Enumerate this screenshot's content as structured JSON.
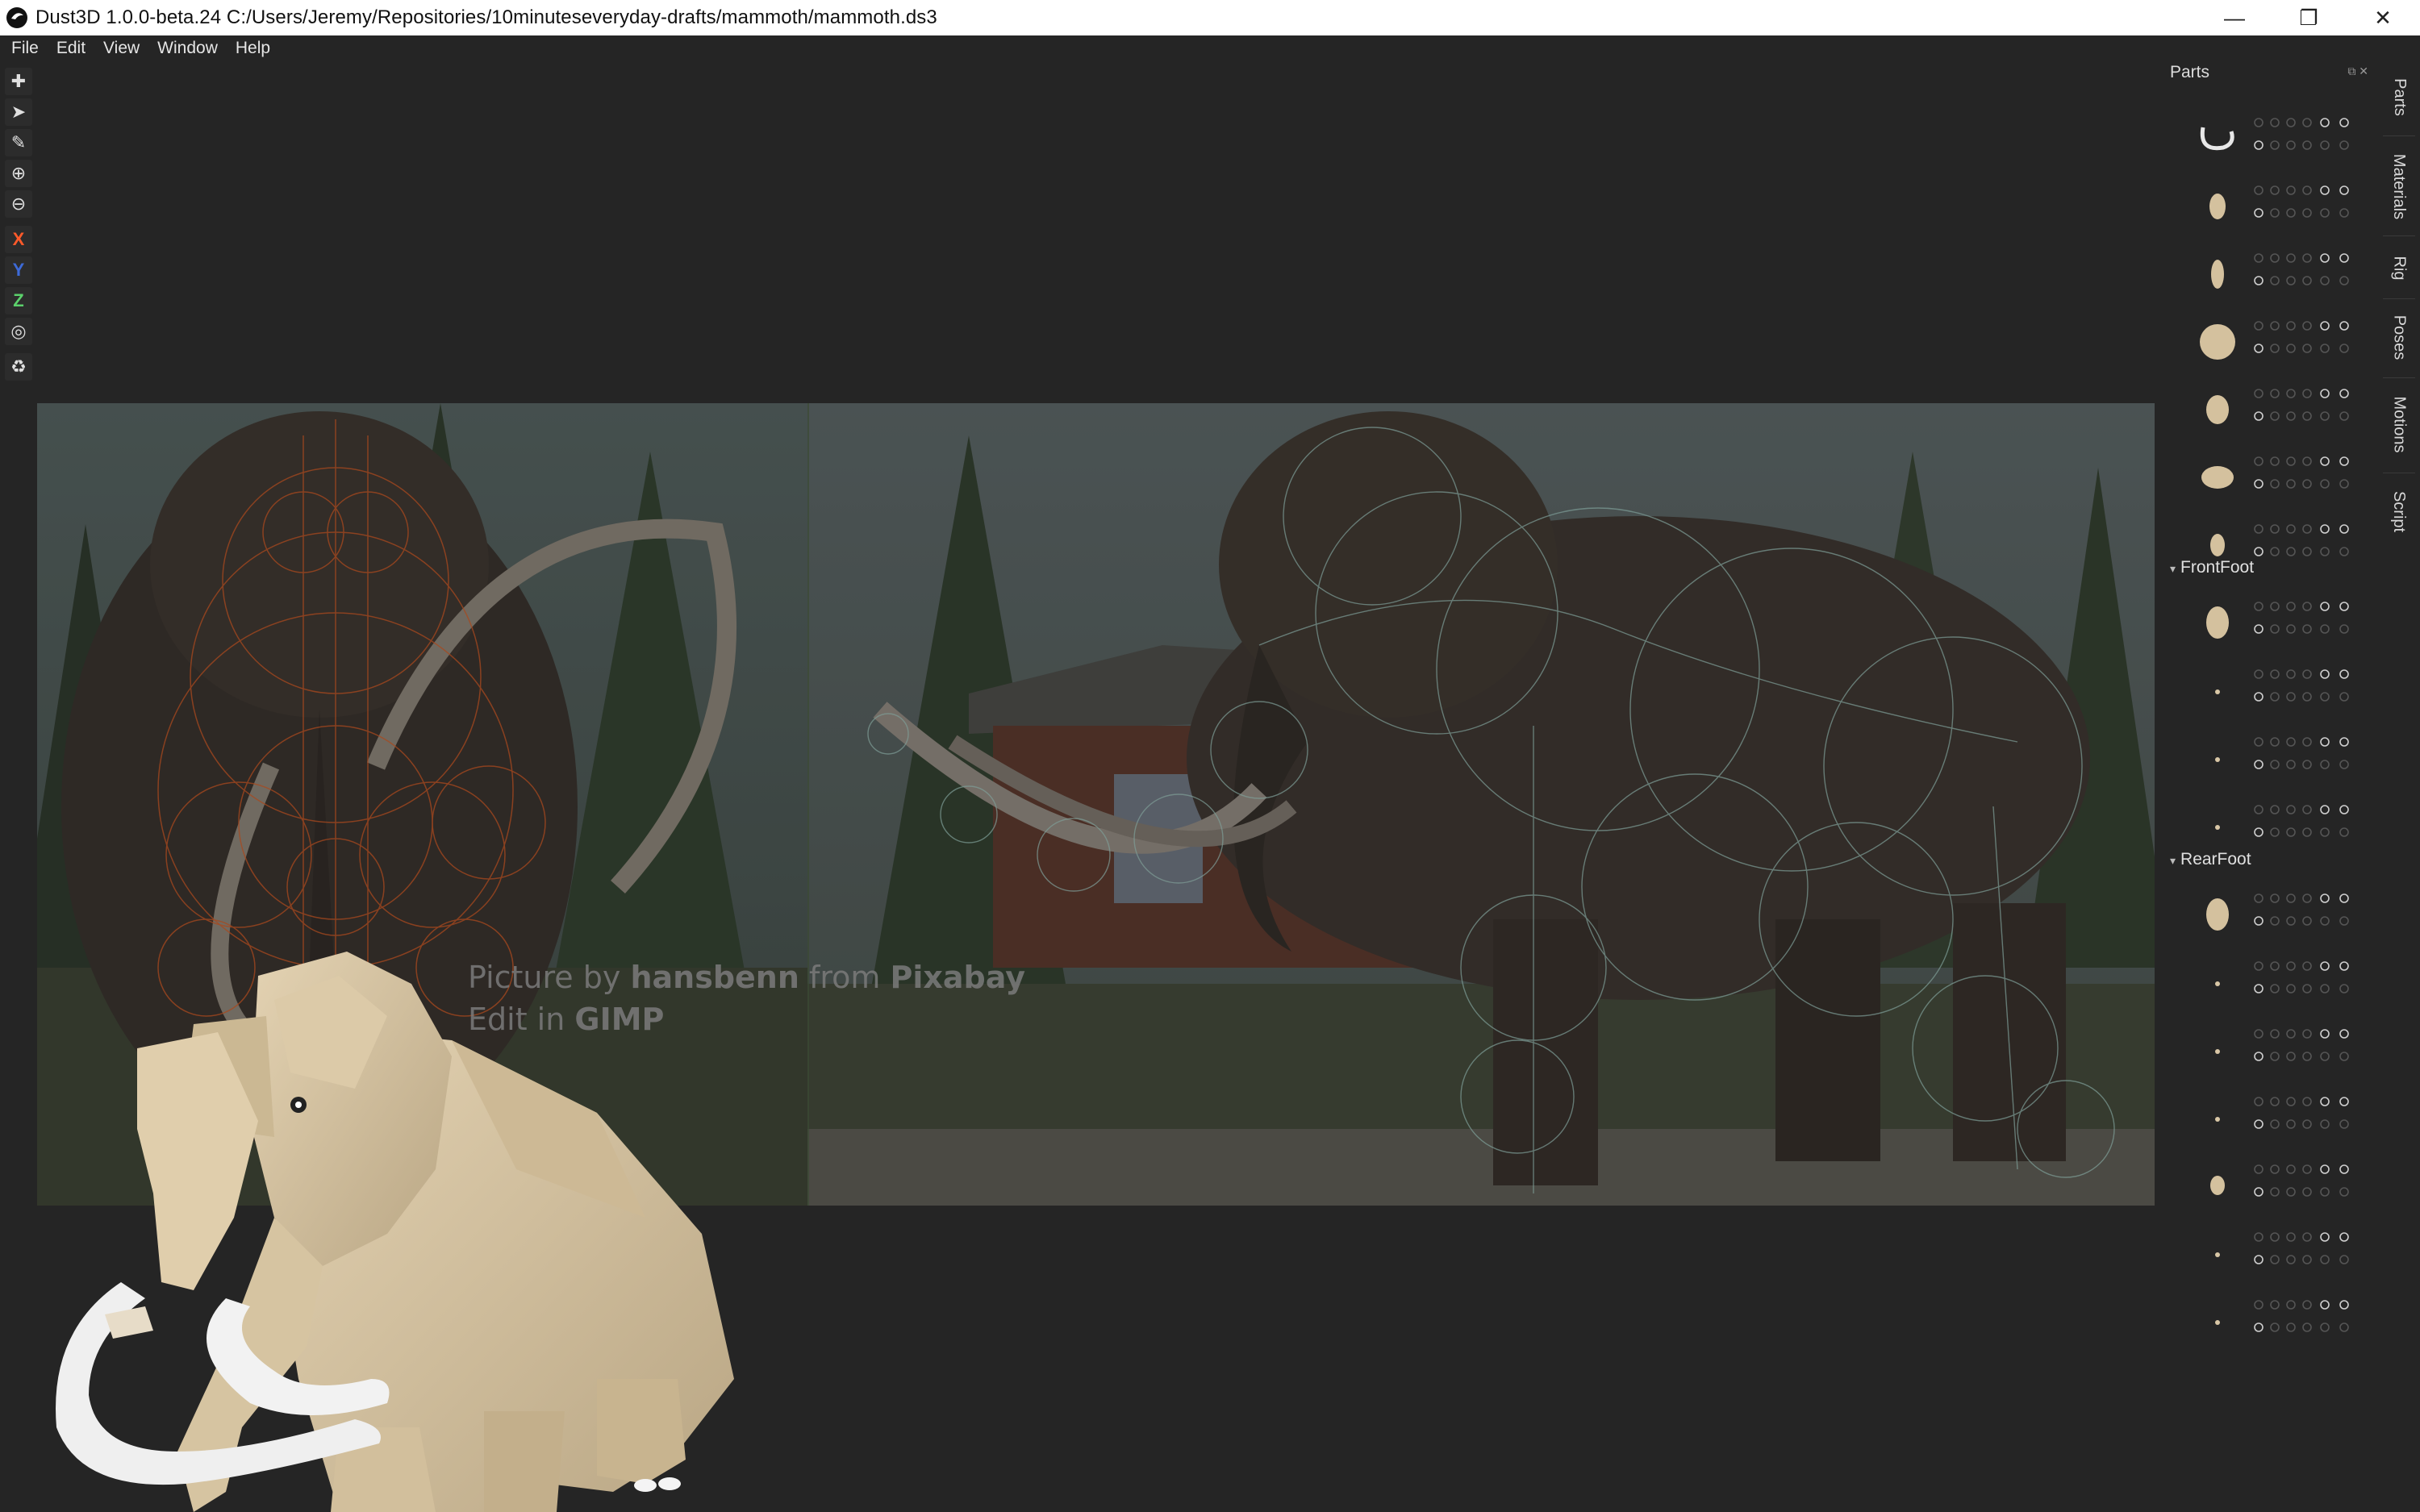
{
  "window": {
    "title": "Dust3D 1.0.0-beta.24 C:/Users/Jeremy/Repositories/10minuteseveryday-drafts/mammoth/mammoth.ds3",
    "minimize": "—",
    "restore": "❐",
    "close": "✕"
  },
  "menu": [
    "File",
    "Edit",
    "View",
    "Window",
    "Help"
  ],
  "toolbar": {
    "add": "✚",
    "select": "➤",
    "paint": "✎",
    "zoom_in": "⊕",
    "zoom_out": "⊖",
    "x": "X",
    "y": "Y",
    "z": "Z",
    "radius": "◎",
    "recycle": "♻"
  },
  "reference": {
    "credit_prefix": "Picture by ",
    "credit_author": "hansbenn",
    "credit_middle": " from ",
    "credit_site": "Pixabay",
    "edit_prefix": "Edit in ",
    "edit_tool": "GIMP"
  },
  "parts_panel": {
    "title": "Parts",
    "controls": "⧉ ✕",
    "groups": [
      {
        "name": "FrontFoot"
      },
      {
        "name": "RearFoot"
      }
    ]
  },
  "side_tabs": [
    "Parts",
    "Materials",
    "Rig",
    "Poses",
    "Motions",
    "Script"
  ],
  "colors": {
    "axis_x": "#ff5a2a",
    "axis_y": "#3d6ad8",
    "axis_z": "#5bd06b",
    "background": "#252525",
    "model_skin": "#d9c7a6",
    "tusk": "#efefef"
  }
}
